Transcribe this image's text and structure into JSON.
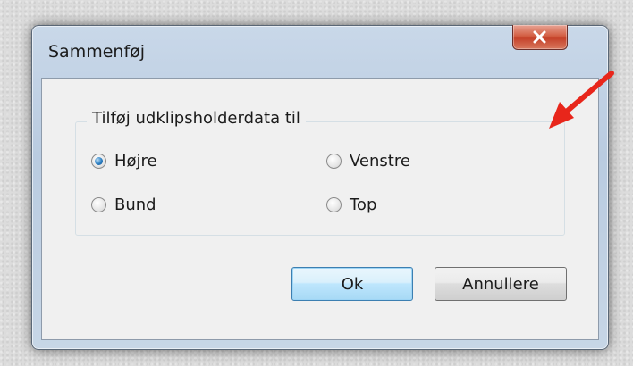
{
  "window": {
    "title": "Sammenføj",
    "close_icon": "close-icon"
  },
  "group": {
    "legend": "Tilføj udklipsholderdata til",
    "options": [
      {
        "label": "Højre",
        "checked": true
      },
      {
        "label": "Venstre",
        "checked": false
      },
      {
        "label": "Bund",
        "checked": false
      },
      {
        "label": "Top",
        "checked": false
      }
    ]
  },
  "buttons": {
    "ok": "Ok",
    "cancel": "Annullere"
  },
  "annotation": {
    "arrow_color": "#e8261b",
    "arrow_icon": "red-arrow-icon"
  },
  "colors": {
    "close_button": "#d35f44",
    "radio_selected": "#2a7ec2"
  }
}
